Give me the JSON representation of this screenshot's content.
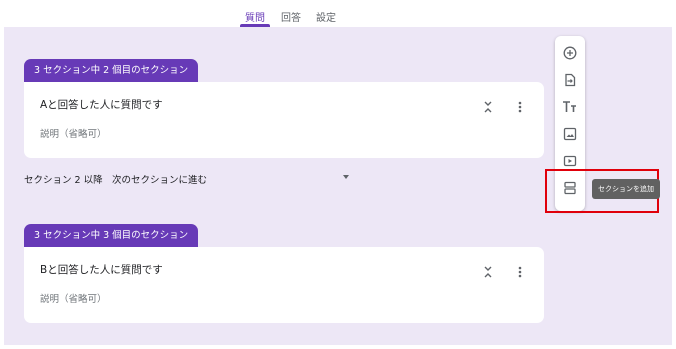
{
  "tabs": [
    {
      "label": "質問"
    },
    {
      "label": "回答"
    },
    {
      "label": "設定"
    }
  ],
  "colors": {
    "accent": "#673ab7",
    "canvas": "#ede7f6",
    "highlight": "#e0000b"
  },
  "sections": [
    {
      "badge": "3 セクション中 2 個目のセクション",
      "title": "Aと回答した人に質問です",
      "description": "説明（省略可）"
    },
    {
      "badge": "3 セクション中 3 個目のセクション",
      "title": "Bと回答した人に質問です",
      "description": "説明（省略可）"
    }
  ],
  "navigation": {
    "label": "セクション 2 以降",
    "selected": "次のセクションに進む"
  },
  "toolbar": {
    "items": [
      {
        "icon": "add-question-icon"
      },
      {
        "icon": "import-questions-icon"
      },
      {
        "icon": "add-title-icon"
      },
      {
        "icon": "add-image-icon"
      },
      {
        "icon": "add-video-icon"
      },
      {
        "icon": "add-section-icon"
      }
    ],
    "tooltip": "セクションを追加"
  }
}
